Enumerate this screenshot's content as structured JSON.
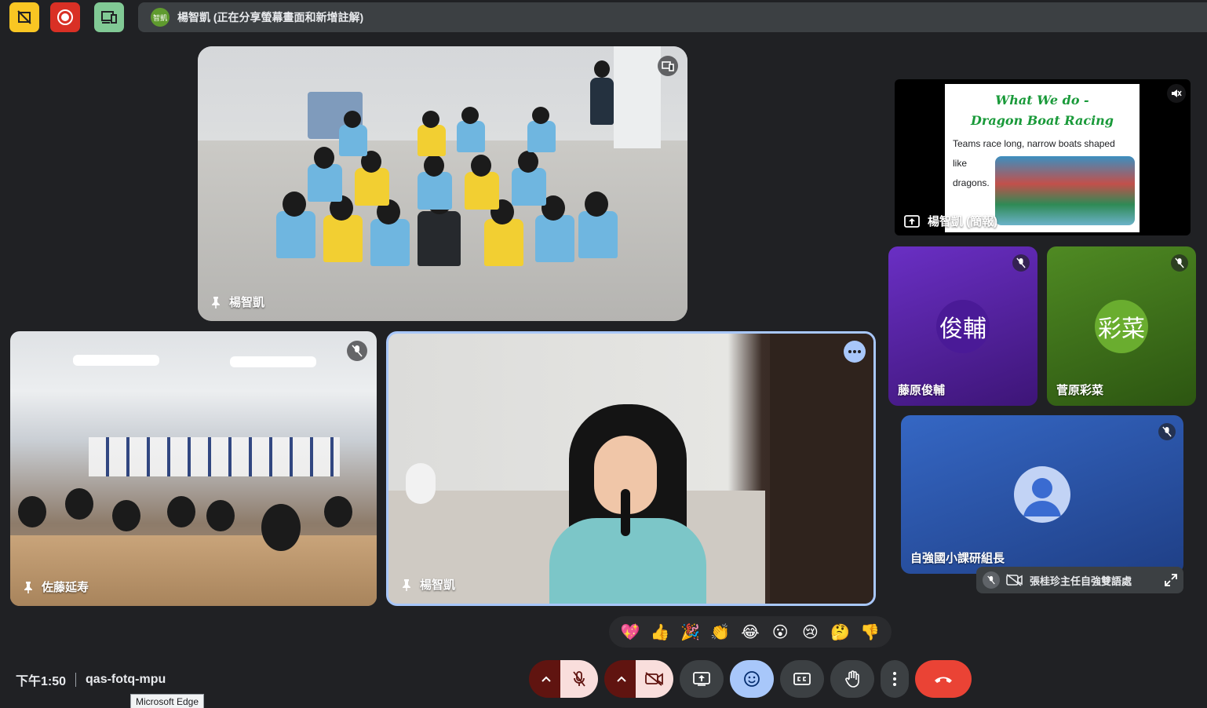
{
  "top_bar": {
    "presenter_avatar_text": "智凱",
    "presenting_text": "楊智凱 (正在分享螢幕畫面和新增註解)"
  },
  "tiles": {
    "main_room_name": "楊智凱",
    "classroom_name": "佐藤延寿",
    "speaker_name": "楊智凱",
    "presentation_name": "楊智凱 (簡報)",
    "slide": {
      "title_line1": "What We do -",
      "title_line2": "Dragon Boat Racing",
      "body": "Teams race long, narrow boats shaped",
      "body2": "like",
      "body3": "dragons."
    },
    "user_a": {
      "initials": "俊輔",
      "name": "藤原俊輔",
      "color": "#5a1fa6"
    },
    "user_b": {
      "initials": "彩菜",
      "name": "菅原彩菜",
      "color": "#3f6d1a"
    },
    "user_c": {
      "name": "自強國小課研組長",
      "color": "#2e56a8"
    },
    "pinned_minimized": "張桂珍主任自強雙語處"
  },
  "reactions": [
    "💖",
    "👍",
    "🎉",
    "👏",
    "😂",
    "😮",
    "😢",
    "🤔",
    "👎"
  ],
  "bottom": {
    "time": "下午1:50",
    "meeting_code": "qas-fotq-mpu",
    "tooltip": "Microsoft Edge"
  },
  "colors": {
    "end_call": "#ea4335",
    "muted_bg": "#f9dedc",
    "reaction_active": "#a8c7fa"
  }
}
